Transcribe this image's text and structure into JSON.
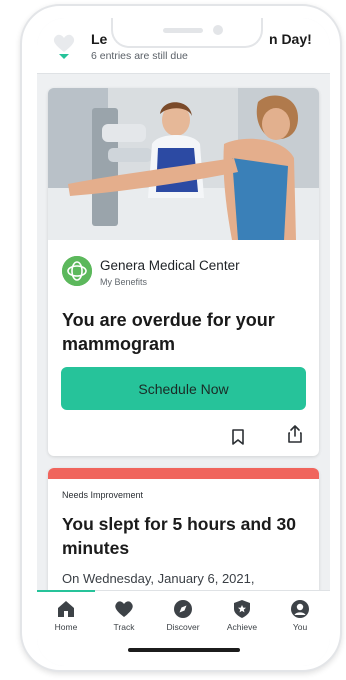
{
  "header": {
    "title_start": "Le",
    "title_end": "n Day!",
    "subtitle": "6 entries are still due",
    "icon": "heart-icon"
  },
  "cards": [
    {
      "provider_name": "Genera Medical Center",
      "provider_sub": "My Benefits",
      "title": "You are overdue for your mammogram",
      "button_label": "Schedule Now",
      "icons": [
        "bookmark-icon",
        "share-icon"
      ]
    },
    {
      "label": "Needs Improvement",
      "title": "You slept for 5 hours and 30 minutes",
      "text": "On Wednesday, January 6, 2021,",
      "stripe_color": "#f0655d"
    }
  ],
  "tabs": [
    {
      "label": "Home",
      "icon": "home-icon",
      "active": true
    },
    {
      "label": "Track",
      "icon": "heart-icon"
    },
    {
      "label": "Discover",
      "icon": "compass-icon"
    },
    {
      "label": "Achieve",
      "icon": "badge-icon"
    },
    {
      "label": "You",
      "icon": "user-icon"
    }
  ],
  "colors": {
    "accent": "#26c39a",
    "alert": "#f0655d"
  }
}
